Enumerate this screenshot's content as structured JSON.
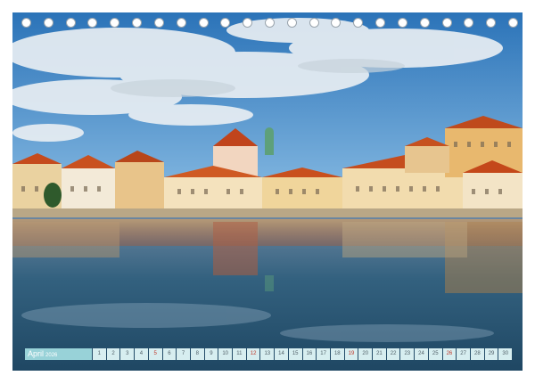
{
  "calendar": {
    "month": "April",
    "year": "2026",
    "days": [
      {
        "n": "1",
        "sun": false
      },
      {
        "n": "2",
        "sun": false
      },
      {
        "n": "3",
        "sun": false
      },
      {
        "n": "4",
        "sun": false
      },
      {
        "n": "5",
        "sun": true
      },
      {
        "n": "6",
        "sun": false
      },
      {
        "n": "7",
        "sun": false
      },
      {
        "n": "8",
        "sun": false
      },
      {
        "n": "9",
        "sun": false
      },
      {
        "n": "10",
        "sun": false
      },
      {
        "n": "11",
        "sun": false
      },
      {
        "n": "12",
        "sun": true
      },
      {
        "n": "13",
        "sun": false
      },
      {
        "n": "14",
        "sun": false
      },
      {
        "n": "15",
        "sun": false
      },
      {
        "n": "16",
        "sun": false
      },
      {
        "n": "17",
        "sun": false
      },
      {
        "n": "18",
        "sun": false
      },
      {
        "n": "19",
        "sun": true
      },
      {
        "n": "20",
        "sun": false
      },
      {
        "n": "21",
        "sun": false
      },
      {
        "n": "22",
        "sun": false
      },
      {
        "n": "23",
        "sun": false
      },
      {
        "n": "24",
        "sun": false
      },
      {
        "n": "25",
        "sun": false
      },
      {
        "n": "26",
        "sun": true
      },
      {
        "n": "27",
        "sun": false
      },
      {
        "n": "28",
        "sun": false
      },
      {
        "n": "29",
        "sun": false
      },
      {
        "n": "30",
        "sun": false
      }
    ]
  },
  "photo": {
    "subject": "riverside-town-panorama",
    "colors": {
      "sky": "#2a6fb0",
      "roof": "#c8501e",
      "wall": "#f0d9a8",
      "water": "#2b5672"
    }
  },
  "binding": {
    "hole_count": 23
  }
}
